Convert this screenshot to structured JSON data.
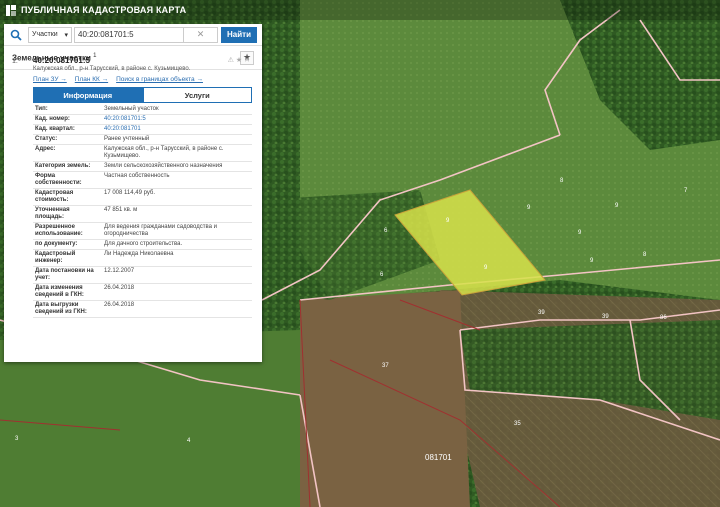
{
  "header": {
    "title": "ПУБЛИЧНАЯ КАДАСТРОВАЯ КАРТА"
  },
  "search": {
    "type_label": "Участки",
    "query": "40:20:081701:5",
    "find_label": "Найти"
  },
  "section": {
    "title": "Земельные участки",
    "count": "1"
  },
  "result": {
    "index": "1.",
    "cad_number": "40:20:081701:5",
    "address": "Калужская обл., р-н Тарусский, в районе с. Кузьмищево.",
    "links": [
      "План ЗУ →",
      "План КК →",
      "Поиск в границах объекта →"
    ],
    "tabs": [
      "Информация",
      "Услуги"
    ]
  },
  "properties": [
    {
      "k": "Тип:",
      "v": "Земельный участок"
    },
    {
      "k": "Кад. номер:",
      "v": "40:20:081701:5"
    },
    {
      "k": "Кад. квартал:",
      "v": "40:20:081701"
    },
    {
      "k": "Статус:",
      "v": "Ранее учтенный"
    },
    {
      "k": "Адрес:",
      "v": "Калужская обл., р-н Тарусский, в районе с. Кузьмищево."
    },
    {
      "k": "Категория земель:",
      "v": "Земли сельскохозяйственного назначения"
    },
    {
      "k": "Форма собственности:",
      "v": "Частная собственность"
    },
    {
      "k": "Кадастровая стоимость:",
      "v": "17 008 114,49 руб."
    },
    {
      "k": "Уточненная площадь:",
      "v": "47 851 кв. м"
    },
    {
      "k": "Разрешенное использование:",
      "v": "Для ведения гражданами садоводства и огородничества"
    },
    {
      "k": "по документу:",
      "v": "Для дачного строительства."
    },
    {
      "k": "Кадастровый инженер:",
      "v": "Ли Надежда Николаевна"
    },
    {
      "k": "Дата постановки на учет:",
      "v": "12.12.2007"
    },
    {
      "k": "Дата изменения сведений в ГКН:",
      "v": "26.04.2018"
    },
    {
      "k": "Дата выгрузки сведений из ГКН:",
      "v": "26.04.2018"
    }
  ],
  "map_labels": {
    "a": "9",
    "b": "9",
    "c": "8",
    "d": "7",
    "e": "9",
    "f": "9",
    "g": "9",
    "h": "9",
    "i": "6",
    "j": "6",
    "k": "8",
    "l": "39",
    "m": "39",
    "n": "86",
    "o": "37",
    "p": "35",
    "q": "081701",
    "r": "3",
    "s": "4"
  },
  "colors": {
    "accent": "#1f6fb4",
    "parcel_fill": "#d7e24a",
    "boundary": "#f2c4c4"
  }
}
